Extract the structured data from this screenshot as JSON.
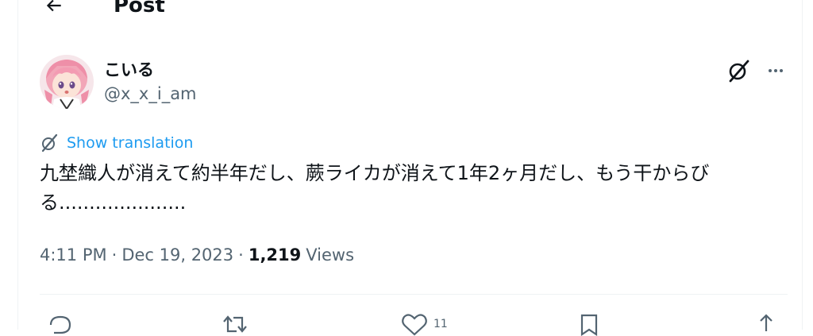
{
  "header": {
    "title": "Post"
  },
  "author": {
    "display_name": "こいる",
    "handle": "@x_x_i_am"
  },
  "translation": {
    "label": "Show translation"
  },
  "tweet": {
    "text": "九埜織人が消えて約半年だし、蕨ライカが消えて1年2ヶ月だし、もう干からびる....................."
  },
  "meta": {
    "time": "4:11 PM",
    "date": "Dec 19, 2023",
    "separator": "·",
    "views_count": "1,219",
    "views_label": "Views"
  },
  "actions": {
    "like_count": "11"
  },
  "colors": {
    "accent": "#1d9bf0",
    "secondary_text": "#536471",
    "primary_text": "#0f1419",
    "border": "#eff3f4"
  }
}
